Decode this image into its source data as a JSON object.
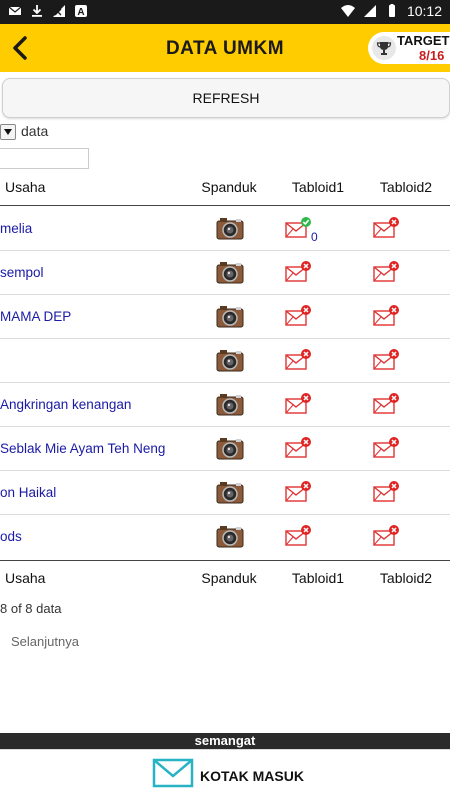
{
  "status_bar": {
    "time": "10:12",
    "left_icons": [
      "mail-icon",
      "download-icon",
      "no-signal-icon",
      "app-a-icon"
    ],
    "right_icons": [
      "wifi-icon",
      "signal-icon",
      "battery-icon"
    ]
  },
  "header": {
    "title": "DATA UMKM",
    "target_label": "TARGET",
    "target_value": "8/16",
    "bg_color": "#ffcc00"
  },
  "refresh_label": "REFRESH",
  "length_label": "data",
  "search": {
    "value": "",
    "placeholder": ""
  },
  "table": {
    "columns": [
      "Usaha",
      "Spanduk",
      "Tabloid1",
      "Tabloid2"
    ],
    "rows": [
      {
        "usaha": "melia",
        "tabloid1": "sent",
        "tabloid1_count": "0",
        "tabloid2": "not-sent"
      },
      {
        "usaha": "sempol",
        "tabloid1": "not-sent",
        "tabloid2": "not-sent"
      },
      {
        "usaha": " MAMA DEP",
        "tabloid1": "not-sent",
        "tabloid2": "not-sent"
      },
      {
        "usaha": "",
        "tabloid1": "not-sent",
        "tabloid2": "not-sent"
      },
      {
        "usaha": " Angkringan kenangan",
        "tabloid1": "not-sent",
        "tabloid2": "not-sent"
      },
      {
        "usaha": "Seblak Mie Ayam Teh Neng",
        "tabloid1": "not-sent",
        "tabloid2": "not-sent"
      },
      {
        "usaha": "on Haikal",
        "tabloid1": "not-sent",
        "tabloid2": "not-sent"
      },
      {
        "usaha": "ods",
        "tabloid1": "not-sent",
        "tabloid2": "not-sent"
      }
    ]
  },
  "info_text": "8 of 8 data",
  "next_label": "Selanjutnya",
  "motto": "semangat",
  "inbox_label": "KOTAK MASUK",
  "colors": {
    "accent": "#ffcc00",
    "link": "#1a1aa6",
    "badge_red": "#e02424",
    "badge_green": "#2fb84a",
    "inbox_icon": "#27b3c4"
  }
}
